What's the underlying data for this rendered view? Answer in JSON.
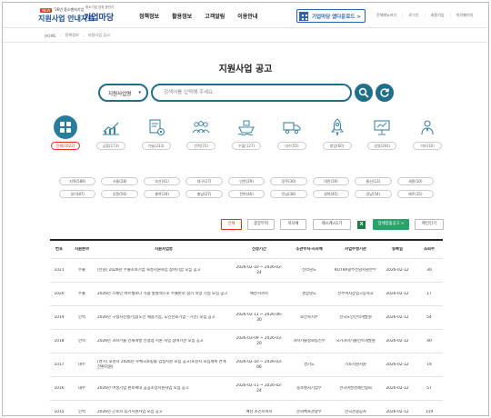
{
  "header": {
    "new_badge": "NEW",
    "logo_sub": "'26년 중소벤처기업",
    "logo_main": "지원사업 안내자료",
    "brand_sub": "중소기업 성장 동반자",
    "brand": "기업마당",
    "nav": [
      "정책정보",
      "활용정보",
      "고객알림",
      "이용안내"
    ],
    "app_download": "기업마당 앱다운로드 >",
    "util": [
      "전체메뉴보기",
      "로그인",
      "회원가입",
      "마이페이지"
    ]
  },
  "breadcrumb": [
    "HOME",
    "정책정보",
    "지원사업 공고"
  ],
  "page_title": "지원사업 공고",
  "search": {
    "select_value": "지원사업명",
    "placeholder": "검색어를 입력해 주세요."
  },
  "categories": [
    {
      "label": "전체(1622)",
      "icon": "grid-icon",
      "active": true
    },
    {
      "label": "금융(173)",
      "icon": "chart-icon",
      "active": false
    },
    {
      "label": "기술(233)",
      "icon": "document-gear-icon",
      "active": false
    },
    {
      "label": "인력(72)",
      "icon": "people-icon",
      "active": false
    },
    {
      "label": "수출(127)",
      "icon": "ship-icon",
      "active": false
    },
    {
      "label": "내수(55)",
      "icon": "truck-icon",
      "active": false
    },
    {
      "label": "창업(60)",
      "icon": "rocket-icon",
      "active": false
    },
    {
      "label": "경영(291)",
      "icon": "presentation-icon",
      "active": false
    },
    {
      "label": "기타(10)",
      "icon": "person-icon",
      "active": false
    }
  ],
  "regions": [
    "지역(589)",
    "서울(28)",
    "부산(41)",
    "대구(27)",
    "인천(29)",
    "광주(30)",
    "대전(19)",
    "울산(13)",
    "세종(10)",
    "경기(87)",
    "강원(56)",
    "충북(34)",
    "충남(27)",
    "전북(46)",
    "전남(38)",
    "경북(45)",
    "경남(54)",
    "제주(15)"
  ],
  "filters": {
    "all": "전체",
    "central": "중앙부처",
    "local": "지자체",
    "sort": "제시계시1기",
    "excel": "X",
    "subscribe": "업체맞춤공고 >",
    "print": "메인인기"
  },
  "table": {
    "headers": [
      "번호",
      "지원분야",
      "지원사업명",
      "신청기간",
      "소관부처·지자체",
      "사업수행기관",
      "등록일",
      "조회수"
    ],
    "rows": [
      [
        "1021",
        "수출",
        "[전남] 2026년 수출초보기업 육성지원사업 참여기업 모집 공고",
        "2026-02-10 ~ 2026-02-24",
        "전라남도",
        "KOTRA광주전남지원본부",
        "2026-02-12",
        "30"
      ],
      [
        "1020",
        "수출",
        "2026년 스페인 바르셀로나 식품 할랄엑스포 수출판로 참가 희망 기업 모집 공고",
        "예산시까지",
        "경상남도",
        "전주여자상업고등학교",
        "2026-02-12",
        "17"
      ],
      [
        "1019",
        "인력",
        "2026년 구정자진행기업(노인 채용기업, 노인진료기업 - 기관) 모집 공고",
        "2026-02-11 ~ 2026-06-30",
        "보건복지부",
        "한국노인인력개발원",
        "2026-02-12",
        "54"
      ],
      [
        "1018",
        "인력",
        "2026년 과학기술 인재개발 인정업 지원 사업 참여기관 모집 공고",
        "2026-03-09 ~ 2026-03-20",
        "과학기술정보통신부",
        "국가과학기술인력개발원",
        "2026-02-12",
        "40"
      ],
      [
        "1017",
        "내수",
        "[경기] 포천시 2026년 우체국쇼핑몰 입점지원 모집 공고(포천시 모집계획 연계 전환지원)",
        "2026-02-10 ~ 2026-03-06",
        "경기도",
        "가포지원지원",
        "2026-02-12",
        "19"
      ],
      [
        "1016",
        "내수",
        "2026년 여성기업 판로확대 공공조달지원사업 모집 공고",
        "2026-02-11 ~ 2026-02-24",
        "중소벤처기업부",
        "한국여성경제인협회",
        "2026-02-12",
        "57"
      ],
      [
        "1015",
        "인력",
        "2026년 근로자 휴가지원사업 모집 공고",
        "예산 소진시까지",
        "문화체육관광부",
        "한국관광공사",
        "2026-02-12",
        "119"
      ]
    ]
  },
  "colors": {
    "accent": "#1f6f8b",
    "active_icon_bg": "#2a7c9c",
    "active_pill": "#e8331f",
    "brand_blue": "#1a4fa0",
    "subscribe_green": "#29a36a"
  }
}
